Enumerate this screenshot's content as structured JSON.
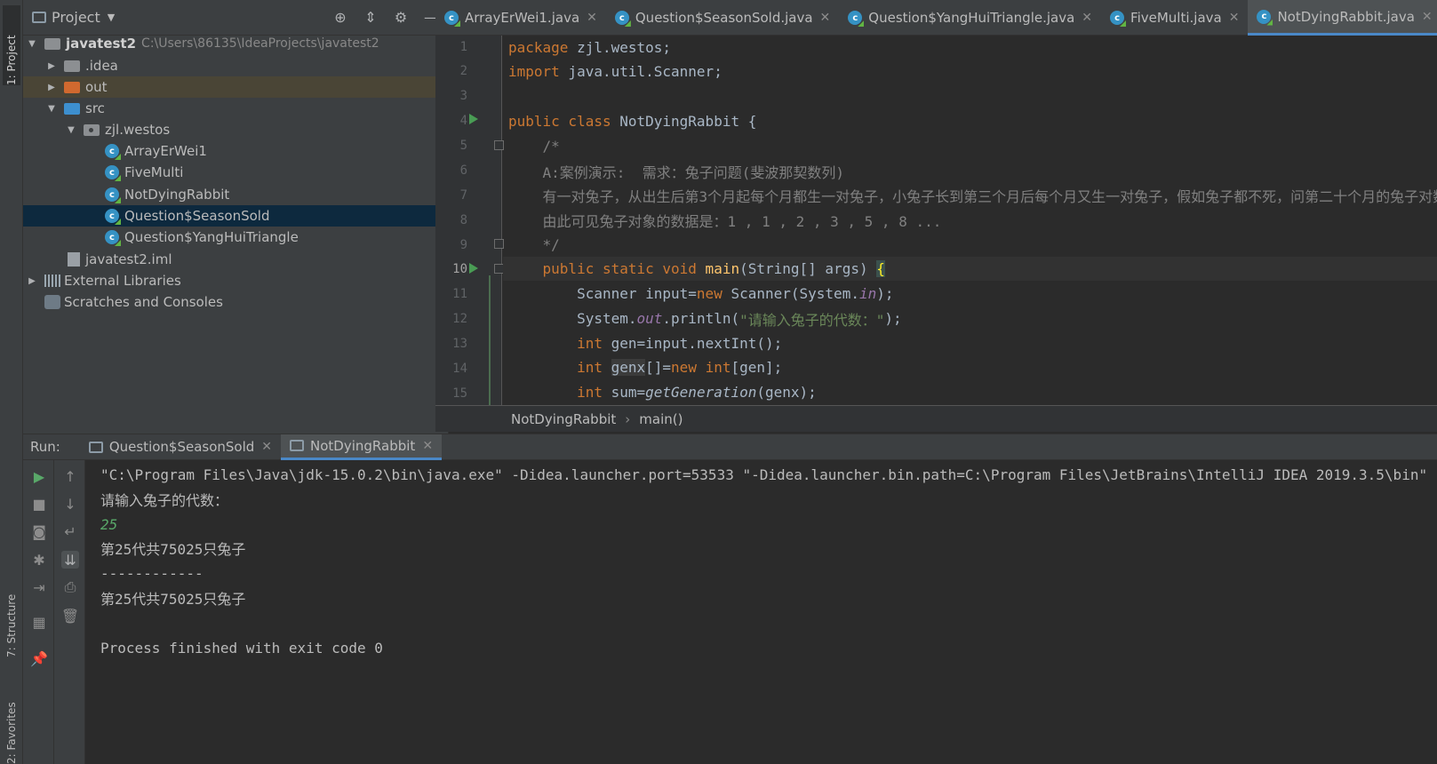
{
  "left_strip": {
    "project_tab": "1: Project",
    "structure_tab": "7: Structure",
    "favorites_tab": "2: Favorites"
  },
  "project_panel": {
    "title": "Project",
    "tree": [
      {
        "label": "javatest2",
        "path": "C:\\Users\\86135\\IdeaProjects\\javatest2"
      },
      {
        "label": ".idea"
      },
      {
        "label": "out"
      },
      {
        "label": "src"
      },
      {
        "label": "zjl.westos"
      },
      {
        "label": "ArrayErWei1"
      },
      {
        "label": "FiveMulti"
      },
      {
        "label": "NotDyingRabbit"
      },
      {
        "label": "Question$SeasonSold"
      },
      {
        "label": "Question$YangHuiTriangle"
      },
      {
        "label": "javatest2.iml"
      },
      {
        "label": "External Libraries"
      },
      {
        "label": "Scratches and Consoles"
      }
    ]
  },
  "editor_tabs": [
    {
      "label": "ArrayErWei1.java"
    },
    {
      "label": "Question$SeasonSold.java"
    },
    {
      "label": "Question$YangHuiTriangle.java"
    },
    {
      "label": "FiveMulti.java"
    },
    {
      "label": "NotDyingRabbit.java"
    }
  ],
  "editor": {
    "line_numbers": [
      "1",
      "2",
      "3",
      "4",
      "5",
      "6",
      "7",
      "8",
      "9",
      "10",
      "11",
      "12",
      "13",
      "14",
      "15"
    ],
    "code": {
      "l1_kw": "package",
      "l1_rest": " zjl.westos;",
      "l2_kw": "import",
      "l2_rest": " java.util.Scanner;",
      "l4_kw": "public class",
      "l4_rest": " NotDyingRabbit {",
      "l5": "    /*",
      "l6": "    A:案例演示:  需求：兔子问题(斐波那契数列)",
      "l7": "    有一对兔子，从出生后第3个月起每个月都生一对兔子，小兔子长到第三个月后每个月又生一对兔子，假如兔子都不死，问第二十个月的兔子对数为多少？",
      "l8": "    由此可见兔子对象的数据是：1 , 1 , 2 , 3 , 5 , 8 ...",
      "l9": "    */",
      "l10_kw": "    public static void",
      "l10_fn": " main",
      "l10_rest": "(String[] args) ",
      "l10_brace": "{",
      "l11_a": "        Scanner input=",
      "l11_kw": "new",
      "l11_b": " Scanner(System.",
      "l11_fld": "in",
      "l11_c": ");",
      "l12_a": "        System.",
      "l12_fld": "out",
      "l12_b": ".println(",
      "l12_str": "\"请输入兔子的代数：\"",
      "l12_c": ");",
      "l13_kw": "        int",
      "l13_rest": " gen=input.nextInt();",
      "l14_kw": "        int",
      "l14_sp": " ",
      "l14_var": "genx",
      "l14_a": "[]=",
      "l14_kw2": "new",
      "l14_kw3": " int",
      "l14_b": "[gen];",
      "l15_kw": "        int",
      "l15_a": " sum=",
      "l15_it": "getGeneration",
      "l15_b": "(genx);"
    }
  },
  "breadcrumb": {
    "class_name": "NotDyingRabbit",
    "method": "main()"
  },
  "run_panel": {
    "label": "Run:",
    "tabs": [
      {
        "label": "Question$SeasonSold"
      },
      {
        "label": "NotDyingRabbit"
      }
    ],
    "console": [
      "\"C:\\Program Files\\Java\\jdk-15.0.2\\bin\\java.exe\" -Didea.launcher.port=53533 \"-Didea.launcher.bin.path=C:\\Program Files\\JetBrains\\IntelliJ IDEA 2019.3.5\\bin\"",
      "请输入兔子的代数：",
      "25",
      "第25代共75025只兔子",
      "------------",
      "第25代共75025只兔子",
      "",
      "Process finished with exit code 0"
    ]
  },
  "colors": {
    "keyword": "#cc7832",
    "string": "#6a8759",
    "comment": "#808080",
    "accent": "#4a88c7",
    "run_green": "#499c54"
  }
}
